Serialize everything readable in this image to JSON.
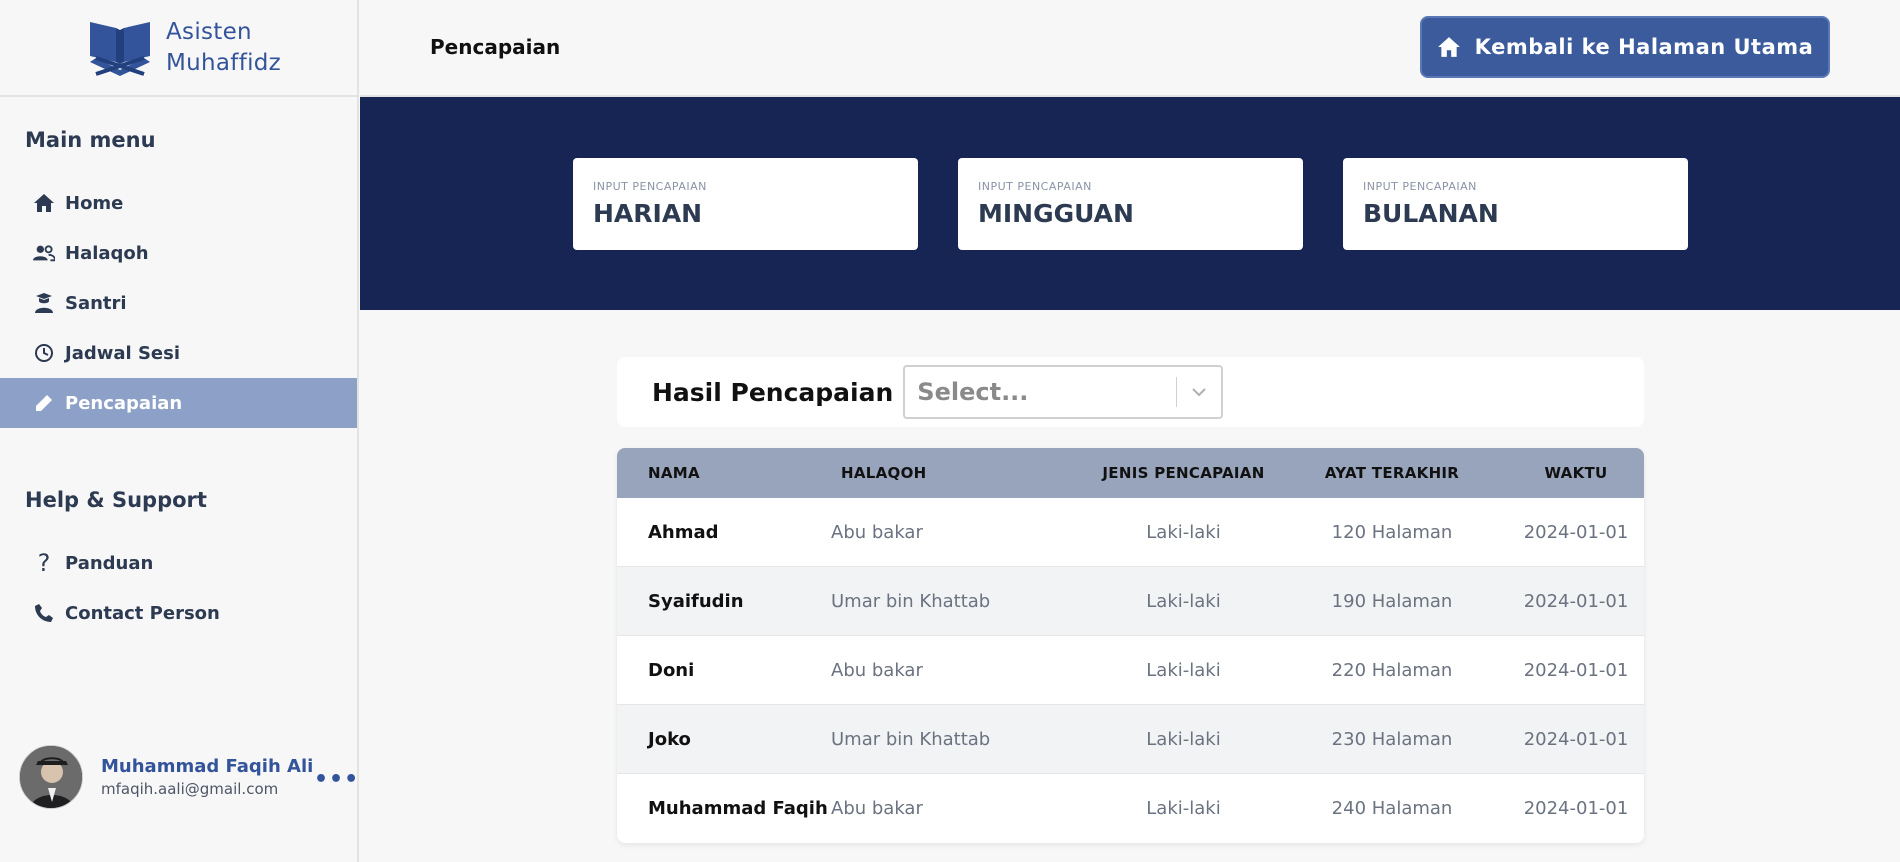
{
  "app": {
    "name_line1": "Asisten",
    "name_line2": "Muhaffidz"
  },
  "sidebar": {
    "main_heading": "Main menu",
    "main_items": [
      {
        "label": "Home",
        "icon": "home-icon"
      },
      {
        "label": "Halaqoh",
        "icon": "users-icon"
      },
      {
        "label": "Santri",
        "icon": "student-icon"
      },
      {
        "label": "Jadwal Sesi",
        "icon": "clock-icon"
      },
      {
        "label": "Pencapaian",
        "icon": "pencil-icon",
        "active": true
      }
    ],
    "help_heading": "Help & Support",
    "help_items": [
      {
        "label": "Panduan",
        "icon": "question-icon"
      },
      {
        "label": "Contact Person",
        "icon": "phone-icon"
      }
    ],
    "user": {
      "name": "Muhammad Faqih Ali",
      "email": "mfaqih.aali@gmail.com",
      "more": "•••"
    }
  },
  "header": {
    "title": "Pencapaian",
    "home_button": "Kembali ke Halaman Utama"
  },
  "cards": [
    {
      "sub": "INPUT PENCAPAIAN",
      "title": "HARIAN"
    },
    {
      "sub": "INPUT PENCAPAIAN",
      "title": "MINGGUAN"
    },
    {
      "sub": "INPUT PENCAPAIAN",
      "title": "BULANAN"
    }
  ],
  "results": {
    "label": "Hasil Pencapaian",
    "select_placeholder": "Select...",
    "columns": [
      "NAMA",
      "HALAQOH",
      "JENIS PENCAPAIAN",
      "AYAT TERAKHIR",
      "WAKTU"
    ],
    "rows": [
      [
        "Ahmad",
        "Abu bakar",
        "Laki-laki",
        "120 Halaman",
        "2024-01-01"
      ],
      [
        "Syaifudin",
        "Umar bin Khattab",
        "Laki-laki",
        "190 Halaman",
        "2024-01-01"
      ],
      [
        "Doni",
        "Abu bakar",
        "Laki-laki",
        "220 Halaman",
        "2024-01-01"
      ],
      [
        "Joko",
        "Umar bin Khattab",
        "Laki-laki",
        "230 Halaman",
        "2024-01-01"
      ],
      [
        "Muhammad Faqih Ali",
        "Abu bakar",
        "Laki-laki",
        "240 Halaman",
        "2024-01-01"
      ]
    ]
  },
  "colors": {
    "brand": "#33549a",
    "hero_bg": "#172555",
    "active_nav": "#8da0c8",
    "table_header": "#97a4bb",
    "button": "#3b5b9c"
  }
}
